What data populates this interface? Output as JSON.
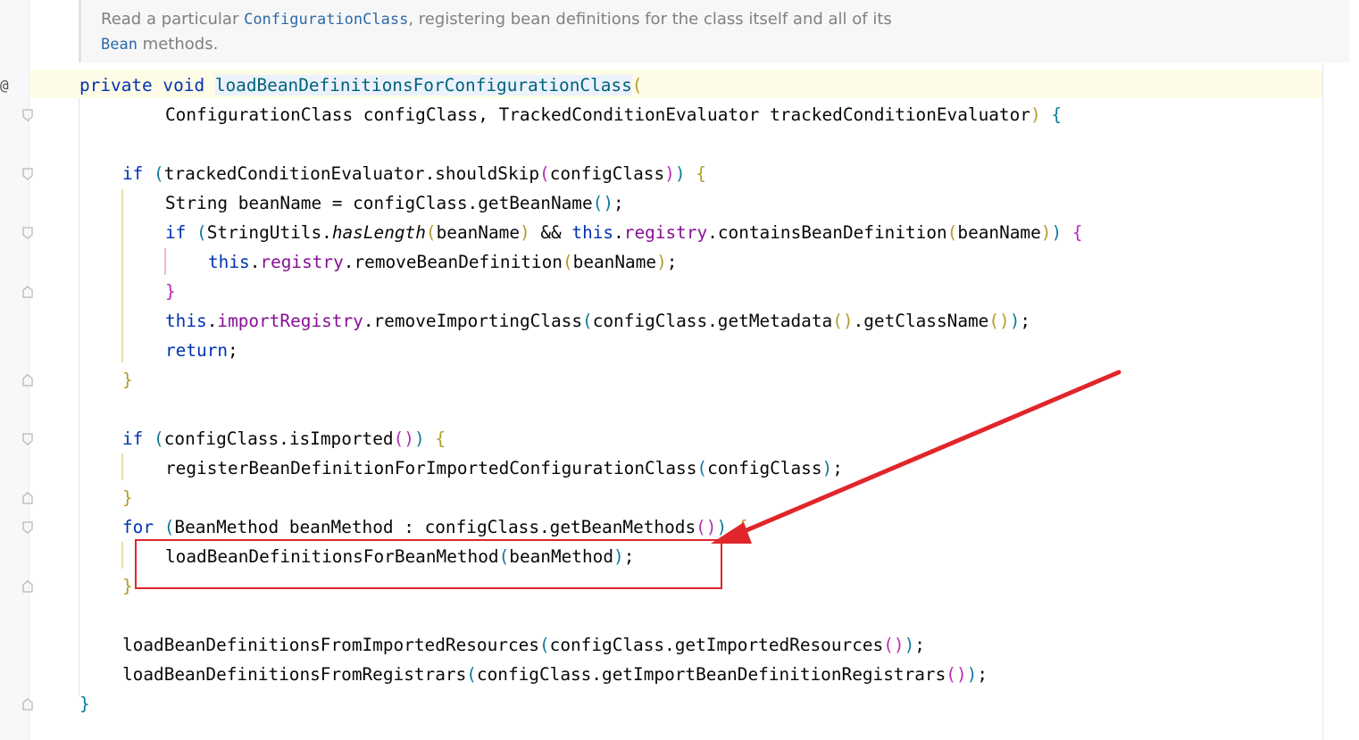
{
  "doc": {
    "t1": "Read a particular ",
    "c1": "ConfigurationClass",
    "t2": ", registering bean definitions for the class itself and all of its",
    "c2": "Bean",
    "t3": " methods."
  },
  "gutter": {
    "marker": "@"
  },
  "code": {
    "l1": {
      "a": "private",
      "b": " ",
      "c": "void",
      "d": " ",
      "e": "loadBeanDefinitionsForConfigurationClass",
      "f": "("
    },
    "l2": {
      "a": "ConfigurationClass configClass, TrackedConditionEvaluator trackedConditionEvaluator",
      "b": ")",
      "c": " ",
      "d": "{"
    },
    "l3": {
      "a": "if",
      "b": " ",
      "c": "(",
      "d": "trackedConditionEvaluator.shouldSkip",
      "e": "(",
      "f": "configClass",
      "g": ")",
      "h": ")",
      "i": " ",
      "j": "{"
    },
    "l4": {
      "a": "String beanName = configClass.getBeanName",
      "b": "()",
      "c": ";"
    },
    "l5": {
      "a": "if",
      "b": " ",
      "c": "(",
      "d": "StringUtils.",
      "e": "hasLength",
      "f": "(",
      "g": "beanName",
      "h": ")",
      "i": " && ",
      "j": "this",
      "k": ".",
      "l": "registry",
      "m": ".containsBeanDefinition",
      "n": "(",
      "o": "beanName",
      "p": ")",
      "q": ")",
      "r": " ",
      "s": "{"
    },
    "l6": {
      "a": "this",
      "b": ".",
      "c": "registry",
      "d": ".removeBeanDefinition",
      "e": "(",
      "f": "beanName",
      "g": ")",
      "h": ";"
    },
    "l7": {
      "a": "}"
    },
    "l8": {
      "a": "this",
      "b": ".",
      "c": "importRegistry",
      "d": ".removeImportingClass",
      "e": "(",
      "f": "configClass.getMetadata",
      "g": "()",
      "h": ".getClassName",
      "i": "()",
      "j": ")",
      "k": ";"
    },
    "l9": {
      "a": "return",
      "b": ";"
    },
    "l10": {
      "a": "}"
    },
    "l11": {
      "a": "if",
      "b": " ",
      "c": "(",
      "d": "configClass.isImported",
      "e": "()",
      "f": ")",
      "g": " ",
      "h": "{"
    },
    "l12": {
      "a": "registerBeanDefinitionForImportedConfigurationClass",
      "b": "(",
      "c": "configClass",
      "d": ")",
      "e": ";"
    },
    "l13": {
      "a": "}"
    },
    "l14": {
      "a": "for",
      "b": " ",
      "c": "(",
      "d": "BeanMethod beanMethod : configClass.getBeanMethods",
      "e": "()",
      "f": ")",
      "g": " ",
      "h": "{"
    },
    "l15": {
      "a": "loadBeanDefinitionsForBeanMethod",
      "b": "(",
      "c": "beanMethod",
      "d": ")",
      "e": ";"
    },
    "l16": {
      "a": "}"
    },
    "l17": {
      "a": "loadBeanDefinitionsFromImportedResources",
      "b": "(",
      "c": "configClass.getImportedResources",
      "d": "()",
      "e": ")",
      "f": ";"
    },
    "l18": {
      "a": "loadBeanDefinitionsFromRegistrars",
      "b": "(",
      "c": "configClass.getImportBeanDefinitionRegistrars",
      "d": "()",
      "e": ")",
      "f": ";"
    },
    "l19": {
      "a": "}"
    }
  },
  "colors": {
    "keyword": "#0033b3",
    "method_decl": "#00627a",
    "field": "#871094",
    "annotation_red": "#e0262b",
    "current_line": "#fefbe6"
  }
}
